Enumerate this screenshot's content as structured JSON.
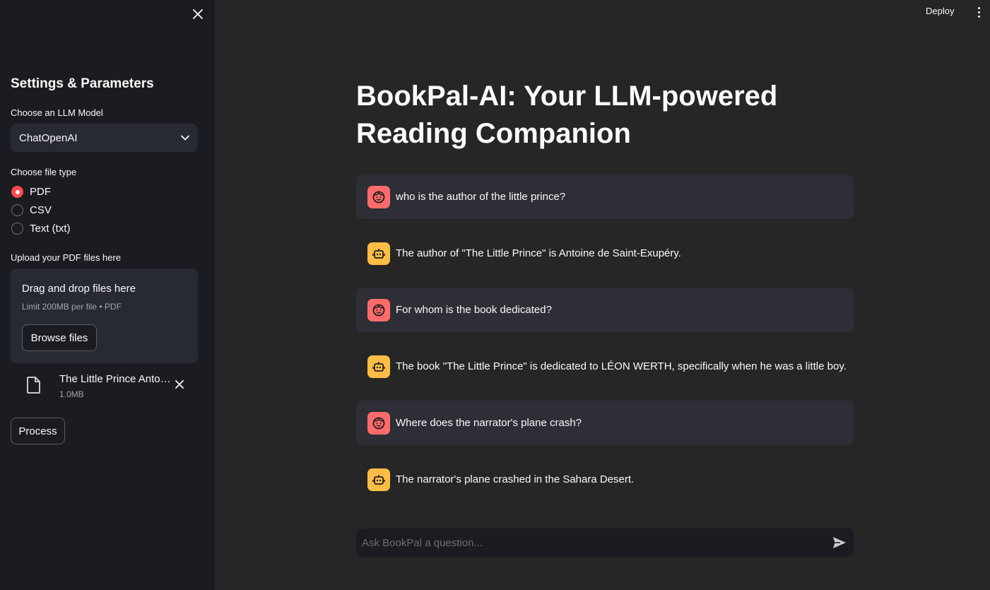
{
  "header": {
    "deploy_label": "Deploy",
    "menu_icon": "kebab-menu-icon"
  },
  "sidebar": {
    "close_icon": "close-icon",
    "title": "Settings & Parameters",
    "model": {
      "label": "Choose an LLM Model",
      "selected": "ChatOpenAI"
    },
    "file_type": {
      "label": "Choose file type",
      "options": [
        {
          "label": "PDF",
          "checked": true
        },
        {
          "label": "CSV",
          "checked": false
        },
        {
          "label": "Text (txt)",
          "checked": false
        }
      ]
    },
    "uploader": {
      "label": "Upload your PDF files here",
      "drop_text": "Drag and drop files here",
      "limit_text": "Limit 200MB per file • PDF",
      "browse_label": "Browse files"
    },
    "uploaded_file": {
      "name": "The Little Prince Antoine de Saint-Exupery.pdf",
      "size": "1.0MB"
    },
    "process_label": "Process"
  },
  "main": {
    "title": "BookPal-AI: Your LLM-powered Reading Companion",
    "messages": [
      {
        "role": "user",
        "text": "who is the author of the little prince?"
      },
      {
        "role": "assistant",
        "text": "The author of \"The Little Prince\" is Antoine de Saint-Exupéry."
      },
      {
        "role": "user",
        "text": "For whom is the book dedicated?"
      },
      {
        "role": "assistant",
        "text": "The book \"The Little Prince\" is dedicated to LÉON WERTH, specifically when he was a little boy."
      },
      {
        "role": "user",
        "text": "Where does the narrator's plane crash?"
      },
      {
        "role": "assistant",
        "text": "The narrator's plane crashed in the Sahara Desert."
      }
    ],
    "chat_input": {
      "placeholder": "Ask BookPal a question...",
      "value": ""
    }
  },
  "colors": {
    "accent": "#ff4b4b",
    "user_avatar": "#ff6b6b",
    "assistant_avatar": "#ffbd45"
  }
}
